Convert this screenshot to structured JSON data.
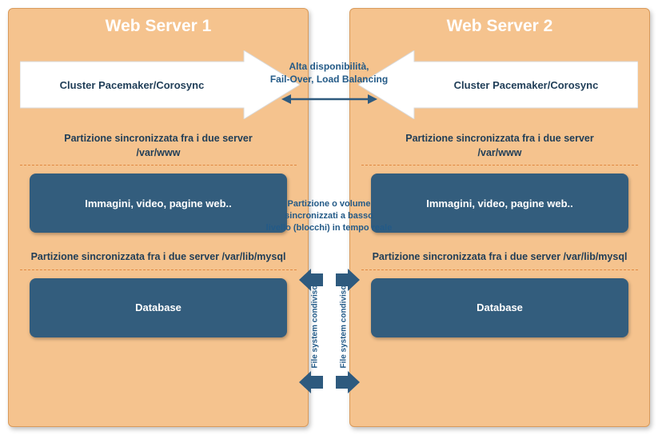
{
  "colors": {
    "panel": "#f5c38e",
    "darkbox": "#335d7d",
    "text": "#1f3d57",
    "arrow": "#2e5a7e"
  },
  "left": {
    "title": "Web Server 1",
    "cluster": "Cluster Pacemaker/Corosync",
    "section1_label": "Partizione sincronizzata fra i due server\n/var/www",
    "box1": "Immagini, video, pagine web..",
    "section2_label": "Partizione sincronizzata fra i due server\n/var/lib/mysql",
    "box2": "Database"
  },
  "right": {
    "title": "Web Server 2",
    "cluster": "Cluster Pacemaker/Corosync",
    "section1_label": "Partizione sincronizzata fra i due server\n/var/www",
    "box1": "Immagini, video, pagine web..",
    "section2_label": "Partizione sincronizzata fra i due server\n/var/lib/mysql",
    "box2": "Database"
  },
  "center": {
    "ha_label": "Alta disponibilità,\nFail-Over, Load Balancing",
    "partition_label": "Partizione o volume\nsincronizzati a basso\nlivello (blocchi) in tempo reale",
    "vertical_label": "File system condiviso"
  }
}
